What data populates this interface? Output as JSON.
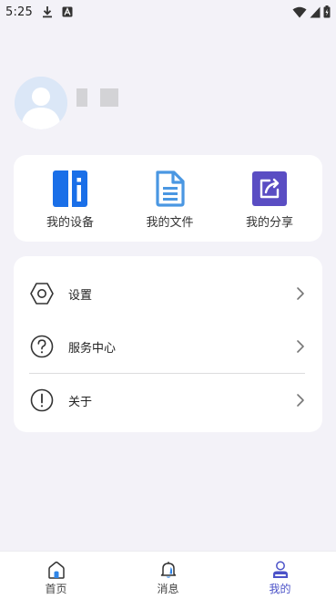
{
  "status_bar": {
    "time": "5:25"
  },
  "quick_actions": [
    {
      "label": "我的设备",
      "icon": "device-icon"
    },
    {
      "label": "我的文件",
      "icon": "file-icon"
    },
    {
      "label": "我的分享",
      "icon": "share-icon"
    }
  ],
  "menu": [
    {
      "label": "设置",
      "icon": "settings-icon"
    },
    {
      "label": "服务中心",
      "icon": "help-icon"
    },
    {
      "label": "关于",
      "icon": "info-icon"
    }
  ],
  "bottom_nav": [
    {
      "label": "首页",
      "active": false
    },
    {
      "label": "消息",
      "active": false
    },
    {
      "label": "我的",
      "active": true
    }
  ],
  "colors": {
    "accent": "#4b52c8",
    "device_blue": "#1a6fe8",
    "file_blue": "#4a97e2",
    "share_purple": "#5a4dc3",
    "background": "#f3f2f8"
  }
}
